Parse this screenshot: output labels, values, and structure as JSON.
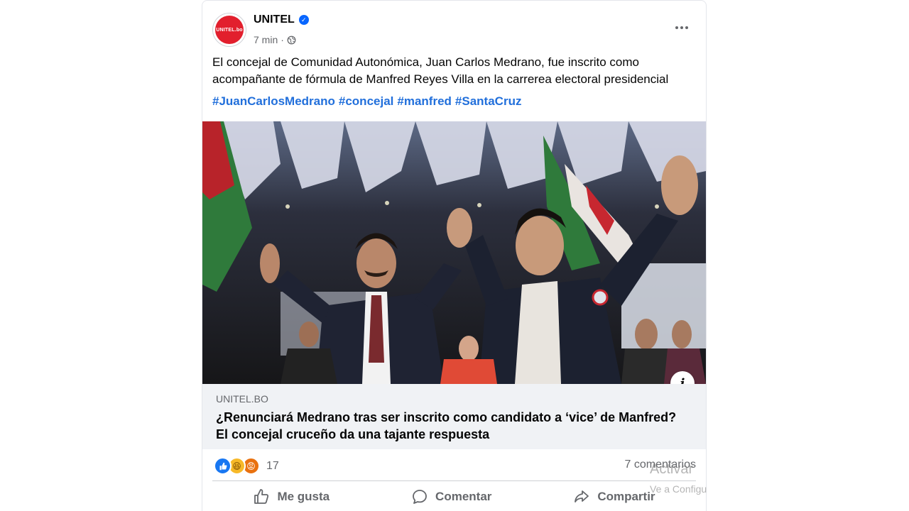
{
  "post": {
    "page_name": "UNITEL",
    "avatar_text": "UNITEL.bo",
    "time": "7 min",
    "separator": "·",
    "text": "El concejal de Comunidad Autonómica, Juan Carlos Medrano, fue inscrito como acompañante de fórmula de Manfred Reyes Villa en la carrerea electoral presidencial",
    "hashtags": [
      "#JuanCarlosMedrano",
      "#concejal",
      "#manfred",
      "#SantaCruz"
    ]
  },
  "link": {
    "domain": "UNITEL.BO",
    "title": "¿Renunciará Medrano tras ser inscrito como candidato a ‘vice’ de Manfred? El concejal cruceño da una tajante respuesta",
    "info_label": "i"
  },
  "stats": {
    "reaction_count": "17",
    "comments": "7 comentarios"
  },
  "actions": {
    "like": "Me gusta",
    "comment": "Comentar",
    "share": "Compartir"
  },
  "overlay": {
    "line1": "Activar",
    "line2": "Ve a Configuración"
  },
  "colors": {
    "brand_red": "#e21f2d",
    "link_blue": "#216fdb",
    "verified_blue": "#0866ff",
    "link_box_bg": "#f0f2f5"
  }
}
